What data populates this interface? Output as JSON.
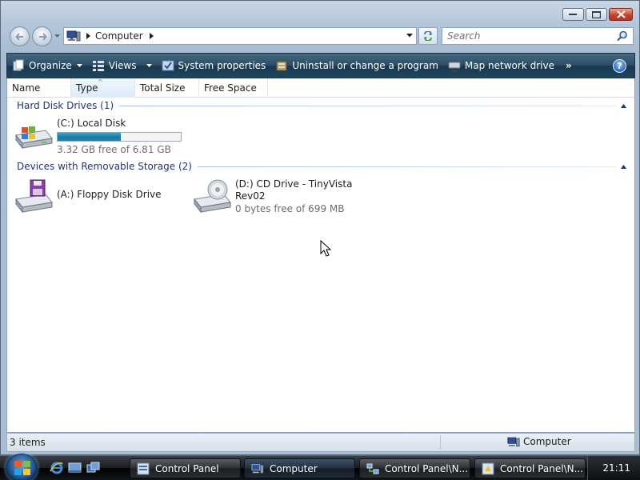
{
  "address": {
    "crumb": "Computer",
    "search_placeholder": "Search"
  },
  "commands": {
    "organize": "Organize",
    "views": "Views",
    "system_properties": "System properties",
    "uninstall": "Uninstall or change a program",
    "map_drive": "Map network drive",
    "more": "»",
    "help": "?"
  },
  "columns": [
    "Name",
    "Type",
    "Total Size",
    "Free Space"
  ],
  "groups": {
    "hdd": {
      "title": "Hard Disk Drives (1)",
      "items": [
        {
          "name": "(C:) Local Disk",
          "free_text": "3.32 GB free of 6.81 GB",
          "used_fraction": 0.512,
          "icon": "hard-drive-icon"
        }
      ]
    },
    "removable": {
      "title": "Devices with Removable Storage (2)",
      "items": [
        {
          "name": "(A:) Floppy Disk Drive",
          "icon": "floppy-drive-icon"
        },
        {
          "name_line1": "(D:) CD Drive - TinyVista",
          "name_line2": "Rev02",
          "free_text": "0 bytes free of 699 MB",
          "icon": "cd-drive-icon"
        }
      ]
    }
  },
  "status": {
    "count": "3 items",
    "location": "Computer"
  },
  "taskbar": {
    "buttons": [
      "Control Panel",
      "Computer",
      "Control Panel\\N...",
      "Control Panel\\N..."
    ],
    "clock": "21:11"
  },
  "colors": {
    "accent": "#1e3287",
    "command_bar": "#2b4f66",
    "capacity_fill": "#157ca6"
  }
}
